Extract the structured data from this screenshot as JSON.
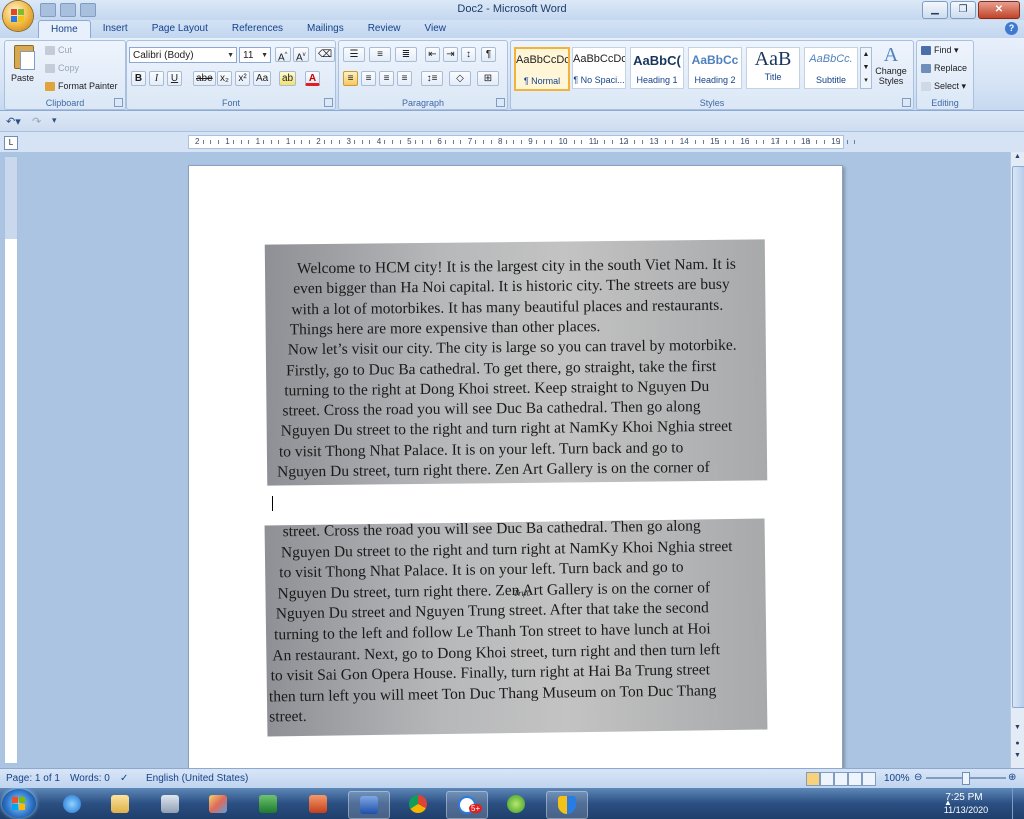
{
  "window": {
    "title": "Doc2 - Microsoft Word"
  },
  "tabs": [
    "Home",
    "Insert",
    "Page Layout",
    "References",
    "Mailings",
    "Review",
    "View"
  ],
  "ribbon": {
    "clipboard": {
      "paste": "Paste",
      "cut": "Cut",
      "copy": "Copy",
      "format_painter": "Format Painter",
      "label": "Clipboard"
    },
    "font": {
      "name": "Calibri (Body)",
      "size": "11",
      "label": "Font"
    },
    "paragraph": {
      "label": "Paragraph"
    },
    "styles": {
      "items": [
        {
          "sample": "AaBbCcDc",
          "name": "¶ Normal"
        },
        {
          "sample": "AaBbCcDc",
          "name": "¶ No Spaci..."
        },
        {
          "sample": "AaBbC(",
          "name": "Heading 1"
        },
        {
          "sample": "AaBbCc",
          "name": "Heading 2"
        },
        {
          "sample": "AaB",
          "name": "Title"
        },
        {
          "sample": "AaBbCc.",
          "name": "Subtitle"
        }
      ],
      "change_styles": "Change Styles",
      "label": "Styles"
    },
    "editing": {
      "find": "Find",
      "replace": "Replace",
      "select": "Select",
      "label": "Editing"
    }
  },
  "ruler": {
    "labels": [
      "2",
      "1",
      "1",
      "1",
      "2",
      "3",
      "4",
      "5",
      "6",
      "7",
      "8",
      "9",
      "10",
      "11",
      "12",
      "13",
      "14",
      "15",
      "16",
      "17",
      "18",
      "19"
    ]
  },
  "document": {
    "image1_lines": [
      "Welcome to HCM city! It is the largest city in the south Viet Nam. It is",
      "even bigger than Ha Noi capital. It is historic city. The streets are busy",
      "with a lot of motorbikes. It has many beautiful places and restaurants.",
      "Things here are more expensive than other places.",
      "Now let’s visit our city. The city is large so you can travel by motorbike.",
      "Firstly, go to Duc Ba cathedral. To get there, go straight, take the first",
      "turning to the right at Dong Khoi street. Keep straight to Nguyen Du",
      "street. Cross the road you will see Duc Ba cathedral. Then go along",
      "Nguyen Du street to the right and turn right at NamKy Khoi Nghia street",
      "to visit Thong Nhat Palace. It is on your left. Turn back and go to",
      "Nguyen Du street, turn right there. Zen Art Gallery is on the corner of"
    ],
    "image2_lines": [
      "street. Cross the road you will see Duc Ba cathedral. Then go along",
      "Nguyen Du street to the right and turn right at NamKy Khoi Nghia street",
      "to visit Thong Nhat Palace. It is on your left. Turn back and go to",
      "Nguyen Du street, turn right there. Zen Art Gallery is on the corner of",
      "Nguyen Du street and Nguyen Trung street. After that take the second",
      "turning to the left and follow Le Thanh Ton street to have lunch at Hoi",
      "An restaurant. Next, go to Dong Khoi street, turn right and then turn left",
      "to visit Sai Gon Opera House. Finally, turn right at Hai Ba Trung street",
      "then turn left you will meet Ton Duc Thang Museum on Ton Duc Thang",
      "street."
    ],
    "handwritten_note": "Trực"
  },
  "status": {
    "page": "Page: 1 of 1",
    "words": "Words: 0",
    "language": "English (United States)",
    "zoom": "100%"
  },
  "taskbar": {
    "time": "7:25 PM",
    "date": "11/13/2020",
    "zalo_badge": "5+"
  },
  "colors": {
    "accent": "#15428b",
    "ribbon_bg": "#dbe7f6",
    "taskbar": "#2b4f82",
    "doc_bg": "#abc4e2"
  }
}
